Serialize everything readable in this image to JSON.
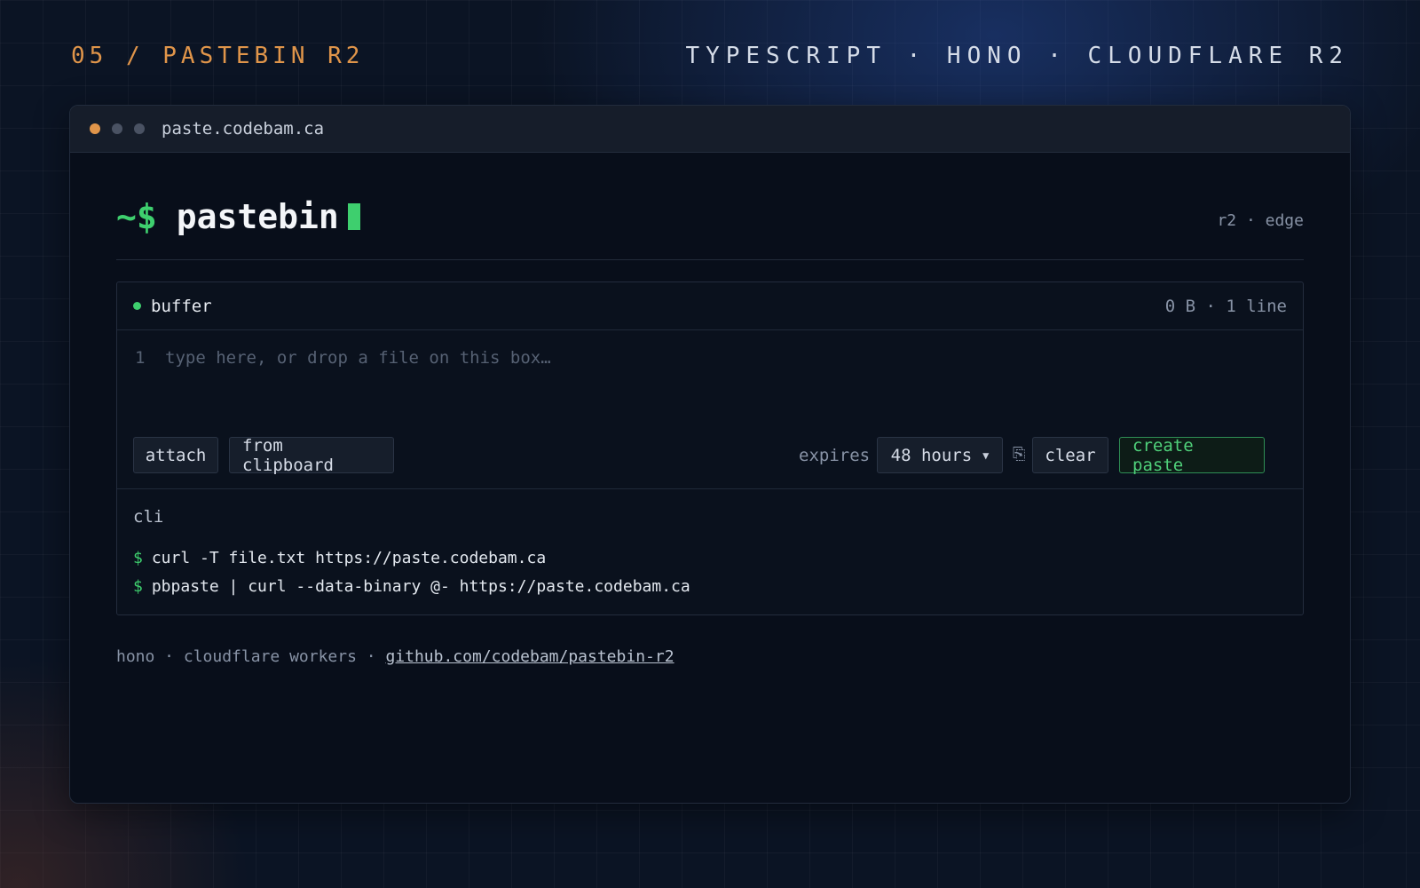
{
  "header": {
    "project": "05 / PASTEBIN R2",
    "stack": "TYPESCRIPT · HONO · CLOUDFLARE R2"
  },
  "window": {
    "url": "paste.codebam.ca"
  },
  "hero": {
    "prompt": "~$",
    "title": "pastebin",
    "tag": "r2 · edge"
  },
  "buffer": {
    "label": "buffer",
    "stats": "0 B · 1 line",
    "line_number": "1",
    "placeholder": "type here, or drop a file on this box…"
  },
  "toolbar": {
    "attach_label": "attach",
    "clipboard_label": "from clipboard",
    "expires_label": "expires",
    "expires_value": "48 hours",
    "clear_label": "clear",
    "create_label": "create paste"
  },
  "cli": {
    "title": "cli",
    "prompt": "$",
    "commands": [
      "curl -T file.txt https://paste.codebam.ca",
      "pbpaste | curl --data-binary @- https://paste.codebam.ca"
    ]
  },
  "footer": {
    "text": "hono · cloudflare workers · ",
    "link": "github.com/codebam/pastebin-r2"
  },
  "colors": {
    "accent_green": "#3ecf6e",
    "accent_orange": "#e0954a",
    "background": "#0b1424"
  }
}
